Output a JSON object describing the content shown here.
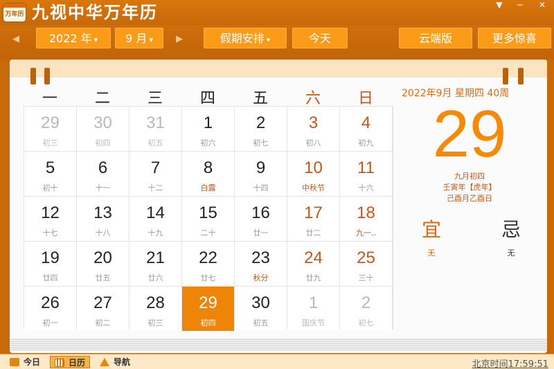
{
  "app": {
    "icon_text": "万年历",
    "title": "九视中华万年历"
  },
  "window": {
    "menu_icon": "▼",
    "min_icon": "−",
    "close_icon": "✕"
  },
  "toolbar": {
    "prev": "◀",
    "next": "▶",
    "year_label": "2022 年",
    "month_label": "9  月",
    "holiday_label": "假期安排",
    "today_label": "今天",
    "cloud_label": "云端版",
    "more_label": "更多惊喜",
    "caret": "▾"
  },
  "weekdays": [
    "一",
    "二",
    "三",
    "四",
    "五",
    "六",
    "日"
  ],
  "calendar": {
    "days": [
      {
        "num": "29",
        "lunar": "初三",
        "type": "other"
      },
      {
        "num": "30",
        "lunar": "初四",
        "type": "other"
      },
      {
        "num": "31",
        "lunar": "初五",
        "type": "other"
      },
      {
        "num": "1",
        "lunar": "初六",
        "type": ""
      },
      {
        "num": "2",
        "lunar": "初七",
        "type": ""
      },
      {
        "num": "3",
        "lunar": "初八",
        "type": "weekend"
      },
      {
        "num": "4",
        "lunar": "初九",
        "type": "weekend"
      },
      {
        "num": "5",
        "lunar": "初十",
        "type": ""
      },
      {
        "num": "6",
        "lunar": "十一",
        "type": ""
      },
      {
        "num": "7",
        "lunar": "十二",
        "type": ""
      },
      {
        "num": "8",
        "lunar": "白露",
        "type": "festival"
      },
      {
        "num": "9",
        "lunar": "十四",
        "type": ""
      },
      {
        "num": "10",
        "lunar": "中秋节",
        "type": "weekend festival"
      },
      {
        "num": "11",
        "lunar": "十六",
        "type": "weekend"
      },
      {
        "num": "12",
        "lunar": "十七",
        "type": ""
      },
      {
        "num": "13",
        "lunar": "十八",
        "type": ""
      },
      {
        "num": "14",
        "lunar": "十九",
        "type": ""
      },
      {
        "num": "15",
        "lunar": "二十",
        "type": ""
      },
      {
        "num": "16",
        "lunar": "廿一",
        "type": ""
      },
      {
        "num": "17",
        "lunar": "廿二",
        "type": "weekend"
      },
      {
        "num": "18",
        "lunar": "九一..",
        "type": "weekend festival"
      },
      {
        "num": "19",
        "lunar": "廿四",
        "type": ""
      },
      {
        "num": "20",
        "lunar": "廿五",
        "type": ""
      },
      {
        "num": "21",
        "lunar": "廿六",
        "type": ""
      },
      {
        "num": "22",
        "lunar": "廿七",
        "type": ""
      },
      {
        "num": "23",
        "lunar": "秋分",
        "type": "festival"
      },
      {
        "num": "24",
        "lunar": "廿九",
        "type": "weekend"
      },
      {
        "num": "25",
        "lunar": "三十",
        "type": "weekend"
      },
      {
        "num": "26",
        "lunar": "初一",
        "type": ""
      },
      {
        "num": "27",
        "lunar": "初二",
        "type": ""
      },
      {
        "num": "28",
        "lunar": "初三",
        "type": ""
      },
      {
        "num": "29",
        "lunar": "初四",
        "type": "today"
      },
      {
        "num": "30",
        "lunar": "初五",
        "type": ""
      },
      {
        "num": "1",
        "lunar": "国庆节",
        "type": "other"
      },
      {
        "num": "2",
        "lunar": "初七",
        "type": "other"
      }
    ]
  },
  "info": {
    "header": "2022年9月  星期四  40周",
    "day": "29",
    "lunar_date": "九月初四",
    "ganzhi_year": "壬寅年【虎年】",
    "ganzhi_month_day": "己酉月乙酉日",
    "yi_label": "宜",
    "yi_value": "无",
    "ji_label": "忌",
    "ji_value": "无"
  },
  "statusbar": {
    "today": "今日",
    "calendar": "日历",
    "nav": "导航",
    "clock": "北京时间17:59:51"
  }
}
